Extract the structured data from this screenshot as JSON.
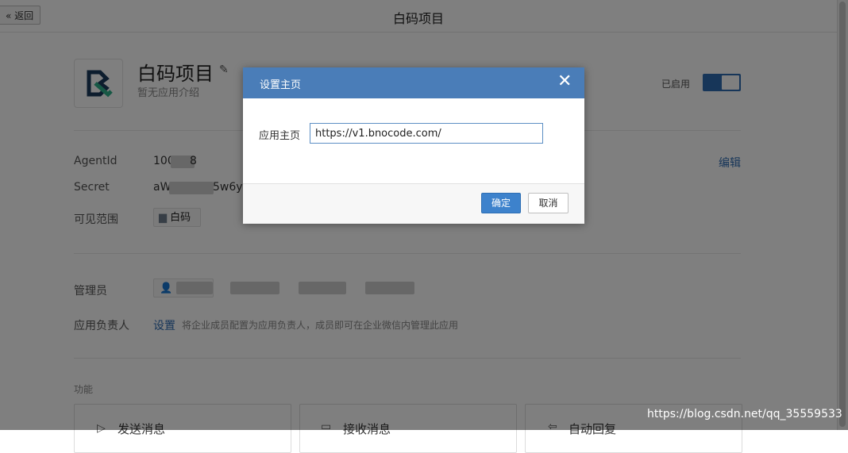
{
  "header": {
    "back_label": "« 返回",
    "title": "白码项目"
  },
  "app": {
    "name": "白码项目",
    "description": "暂无应用介绍",
    "enabled_label": "已启用",
    "enabled": true
  },
  "info": {
    "agentid_label": "AgentId",
    "agentid_value": "100",
    "secret_label": "Secret",
    "secret_value_start": "aW",
    "secret_value_end": "5w6y",
    "edit_link": "编辑",
    "visibility_label": "可见范围",
    "visibility_value": "白码"
  },
  "admins": {
    "label": "管理员"
  },
  "owner": {
    "label": "应用负责人",
    "set_link": "设置",
    "hint": "将企业成员配置为应用负责人，成员即可在企业微信内管理此应用"
  },
  "features": {
    "section_label": "功能",
    "cards": [
      {
        "label": "发送消息"
      },
      {
        "label": "接收消息"
      },
      {
        "label": "自动回复"
      }
    ]
  },
  "dialog": {
    "title": "设置主页",
    "field_label": "应用主页",
    "field_value": "https://v1.bnocode.com/",
    "ok_label": "确定",
    "cancel_label": "取消"
  },
  "watermark": "https://blog.csdn.net/qq_35559533",
  "colors": {
    "accent": "#2f6cb3",
    "dialog_header": "#4a7db8",
    "primary_button": "#3d82cc"
  }
}
